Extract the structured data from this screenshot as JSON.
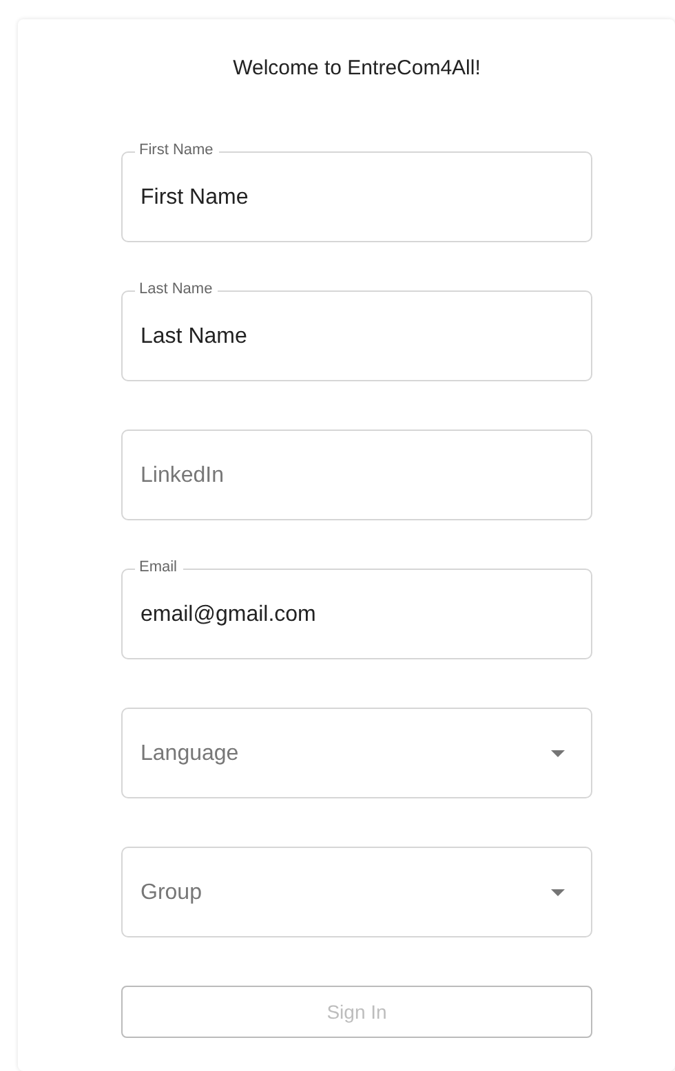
{
  "title": "Welcome to EntreCom4All!",
  "fields": [
    {
      "kind": "text",
      "label": "First Name",
      "value": "First Name"
    },
    {
      "kind": "text",
      "label": "Last Name",
      "value": "Last Name"
    },
    {
      "kind": "text",
      "placeholder": "LinkedIn"
    },
    {
      "kind": "text",
      "label": "Email",
      "value": "email@gmail.com"
    },
    {
      "kind": "select",
      "placeholder": "Language"
    },
    {
      "kind": "select",
      "placeholder": "Group"
    }
  ],
  "button": {
    "label": "Sign In",
    "disabled": true
  }
}
